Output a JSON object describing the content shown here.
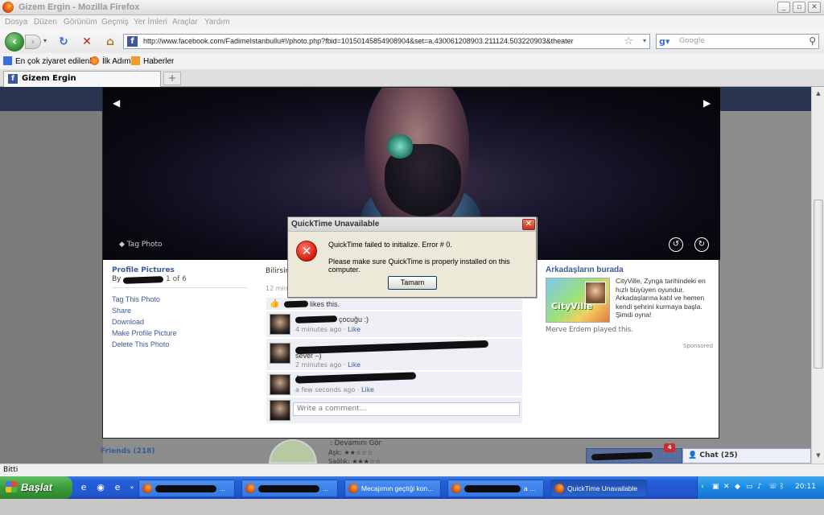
{
  "window": {
    "title": "Gizem Ergin - Mozilla Firefox",
    "menu": [
      "Dosya",
      "Düzen",
      "Görünüm",
      "Geçmiş",
      "Yer İmleri",
      "Araçlar",
      "Yardım"
    ]
  },
  "navbar": {
    "url": "http://www.facebook.com/FadimeIstanbullu#!/photo.php?fbid=10150145854908904&set=a.430061208903.211124.503220903&theater",
    "search_placeholder": "Google"
  },
  "bookmarks": [
    "En çok ziyaret edilenler",
    "İlk Adım",
    "Haberler"
  ],
  "tab": {
    "label": "Gizem Ergin",
    "new_tab": "+"
  },
  "photo": {
    "tag_label": "Tag Photo",
    "prev": "◀",
    "next": "▶"
  },
  "left_panel": {
    "album": "Profile Pictures",
    "by": "By",
    "position": "1 of 6",
    "actions": [
      "Tag This Photo",
      "Share",
      "Download",
      "Make Profile Picture",
      "Delete This Photo"
    ]
  },
  "middle_panel": {
    "caption": "Bilirsin",
    "posted": "12 minu",
    "likes": "likes this.",
    "comments": [
      {
        "text": "çocuğu :)",
        "time": "4 minutes ago",
        "like": "Like"
      },
      {
        "text": "sever –)",
        "time": "2 minutes ago",
        "like": "Like"
      },
      {
        "text": "A",
        "time": "a few seconds ago",
        "like": "Like"
      }
    ],
    "comment_placeholder": "Write a comment..."
  },
  "right_panel": {
    "heading": "Arkadaşların burada",
    "ad_logo": "CityVille",
    "ad_text": "CityVille, Zynga tarihindeki en hızlı büyüyen oyundur. Arkadaşlarına katıl ve hemen kendi şehrini kurmaya başla. Şimdi oyna!",
    "played": "Merve Erdem played this.",
    "sponsored": "Sponsored"
  },
  "page_bottom": {
    "friends": "Friends (218)",
    "devamini": ": Devamını Gör",
    "ask": "Aşk: ★★☆☆☆",
    "saglik": "Sağlık: ★★★☆☆"
  },
  "chat": {
    "label": "Chat (25)",
    "notif_count": "4"
  },
  "dialog": {
    "title": "QuickTime Unavailable",
    "message1": "QuickTime failed to initialize.  Error # 0.",
    "message2": "Please make sure QuickTime is properly installed on this computer.",
    "ok_label": "Tamam"
  },
  "status": {
    "text": "Bitti"
  },
  "taskbar": {
    "start": "Başlat",
    "tasks": [
      {
        "label": "..."
      },
      {
        "label": "..."
      },
      {
        "label": "Mecajımın geçtiği kon..."
      },
      {
        "label": "a ..."
      },
      {
        "label": "QuickTime Unavailable"
      }
    ],
    "clock": "20:11"
  },
  "colors": {
    "facebook_blue": "#3b5998",
    "xp_taskbar": "#245ed6",
    "xp_start_green": "#3c9a3c",
    "error_red": "#d01a0a"
  }
}
